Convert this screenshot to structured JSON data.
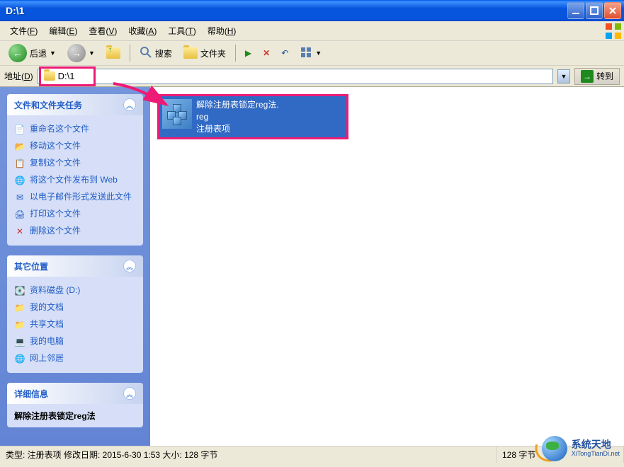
{
  "window": {
    "title": "D:\\1"
  },
  "menu": {
    "file": "文件(F)",
    "edit": "编辑(E)",
    "view": "查看(V)",
    "favorites": "收藏(A)",
    "tools": "工具(T)",
    "help": "帮助(H)"
  },
  "toolbar": {
    "back": "后退",
    "search": "搜索",
    "folders": "文件夹"
  },
  "address": {
    "label": "地址(D)",
    "value": "D:\\1",
    "go": "转到"
  },
  "sidebar": {
    "panels": [
      {
        "title": "文件和文件夹任务",
        "tasks": [
          {
            "label": "重命名这个文件",
            "icon": "rename"
          },
          {
            "label": "移动这个文件",
            "icon": "move"
          },
          {
            "label": "复制这个文件",
            "icon": "copy"
          },
          {
            "label": "将这个文件发布到 Web",
            "icon": "web"
          },
          {
            "label": "以电子邮件形式发送此文件",
            "icon": "email"
          },
          {
            "label": "打印这个文件",
            "icon": "print"
          },
          {
            "label": "删除这个文件",
            "icon": "delete"
          }
        ]
      },
      {
        "title": "其它位置",
        "tasks": [
          {
            "label": "资料磁盘 (D:)",
            "icon": "drive"
          },
          {
            "label": "我的文档",
            "icon": "docs"
          },
          {
            "label": "共享文档",
            "icon": "shared"
          },
          {
            "label": "我的电脑",
            "icon": "computer"
          },
          {
            "label": "网上邻居",
            "icon": "network"
          }
        ]
      },
      {
        "title": "详细信息",
        "tasks": []
      }
    ],
    "details_line": "解除注册表锁定reg法"
  },
  "content": {
    "file": {
      "name_line1": "解除注册表锁定reg法.",
      "name_line2": "reg",
      "type": "注册表项"
    }
  },
  "statusbar": {
    "left": "类型: 注册表项 修改日期: 2015-6-30 1:53 大小: 128 字节",
    "right": "128 字节"
  },
  "watermark": {
    "cn": "系统天地",
    "url": "XiTongTianDi.net"
  },
  "annotation": {
    "arrow_color": "#ed1b76",
    "highlight_color": "#ed1b76"
  }
}
